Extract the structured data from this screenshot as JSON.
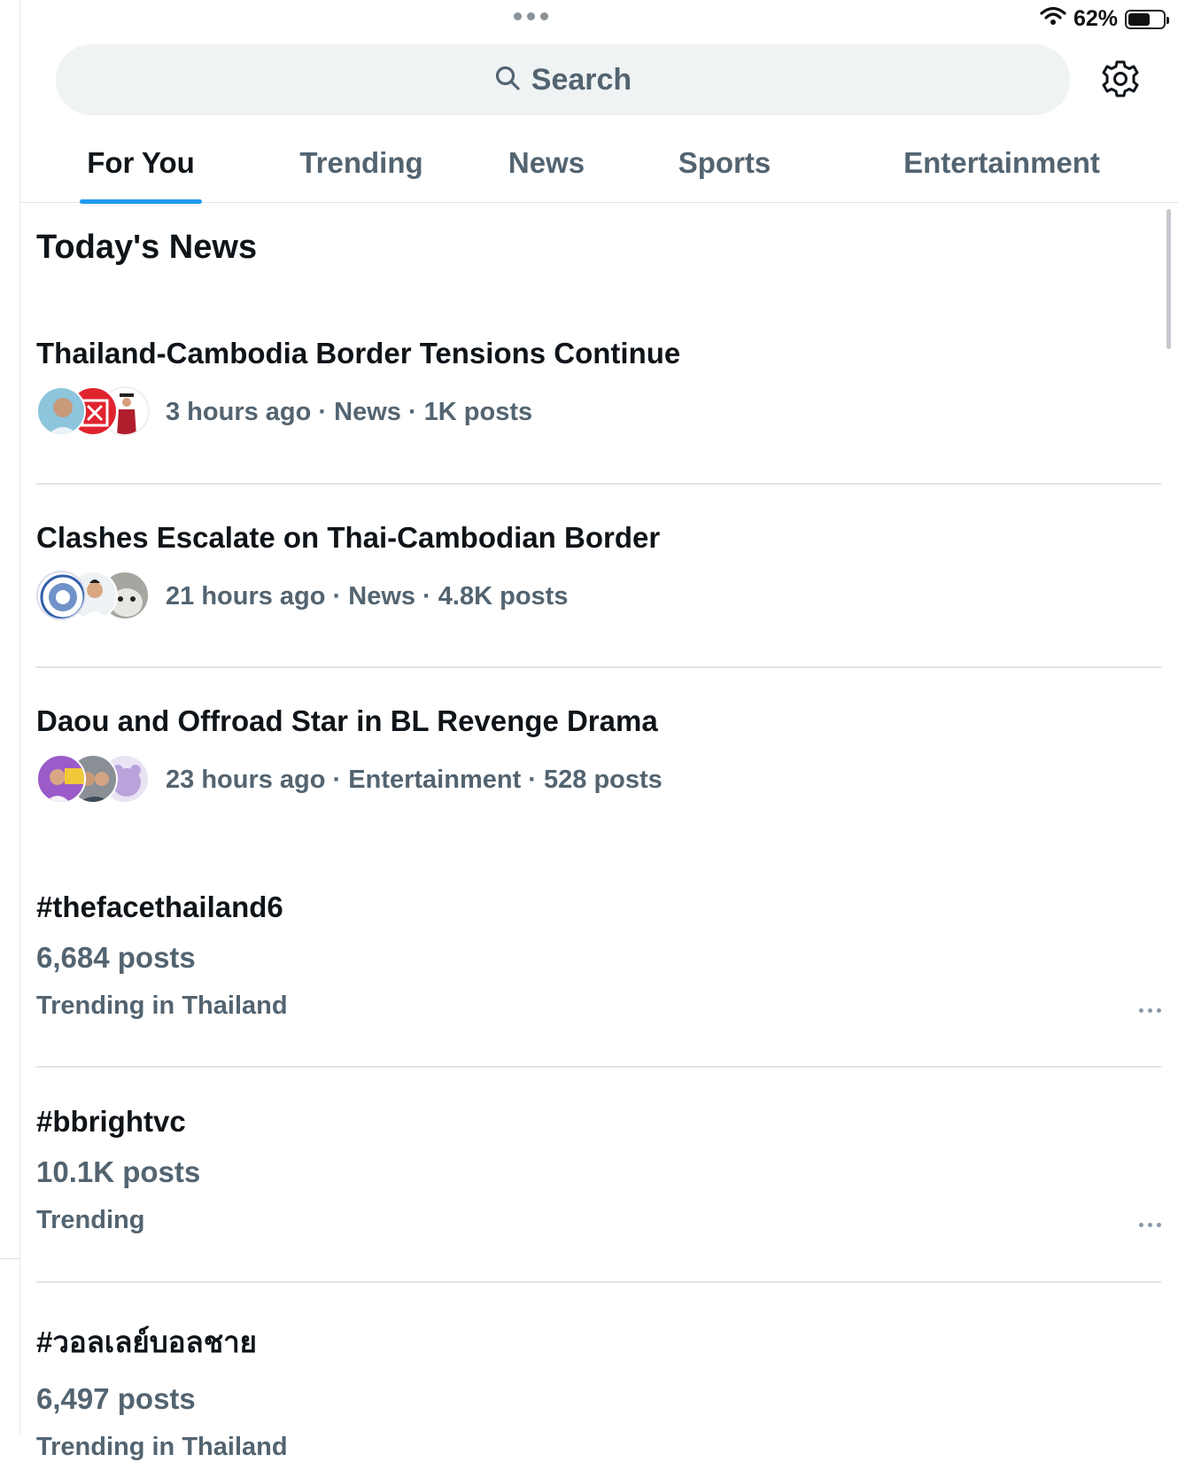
{
  "status_bar": {
    "battery_percent": "62%",
    "battery_level": 0.62
  },
  "search": {
    "label": "Search"
  },
  "tabs": [
    {
      "label": "For You",
      "active": true
    },
    {
      "label": "Trending",
      "active": false
    },
    {
      "label": "News",
      "active": false
    },
    {
      "label": "Sports",
      "active": false
    },
    {
      "label": "Entertainment",
      "active": false
    }
  ],
  "section": {
    "title": "Today's News"
  },
  "news": [
    {
      "headline": "Thailand-Cambodia Border Tensions Continue",
      "meta": "3 hours ago · News · 1K posts"
    },
    {
      "headline": "Clashes Escalate on Thai-Cambodian Border",
      "meta": "21 hours ago · News · 4.8K posts"
    },
    {
      "headline": "Daou and Offroad Star in BL Revenge Drama",
      "meta": "23 hours ago · Entertainment · 528 posts"
    }
  ],
  "trends": [
    {
      "tag": "#thefacethailand6",
      "count": "6,684 posts",
      "context": "Trending in Thailand"
    },
    {
      "tag": "#bbrightvc",
      "count": "10.1K posts",
      "context": "Trending"
    },
    {
      "tag": "#วอลเลย์บอลชาย",
      "count": "6,497 posts",
      "context": "Trending in Thailand"
    }
  ],
  "colors": {
    "accent": "#1d9bf0",
    "text_primary": "#0f1419",
    "text_secondary": "#536471",
    "search_bg": "#eff3f4"
  }
}
